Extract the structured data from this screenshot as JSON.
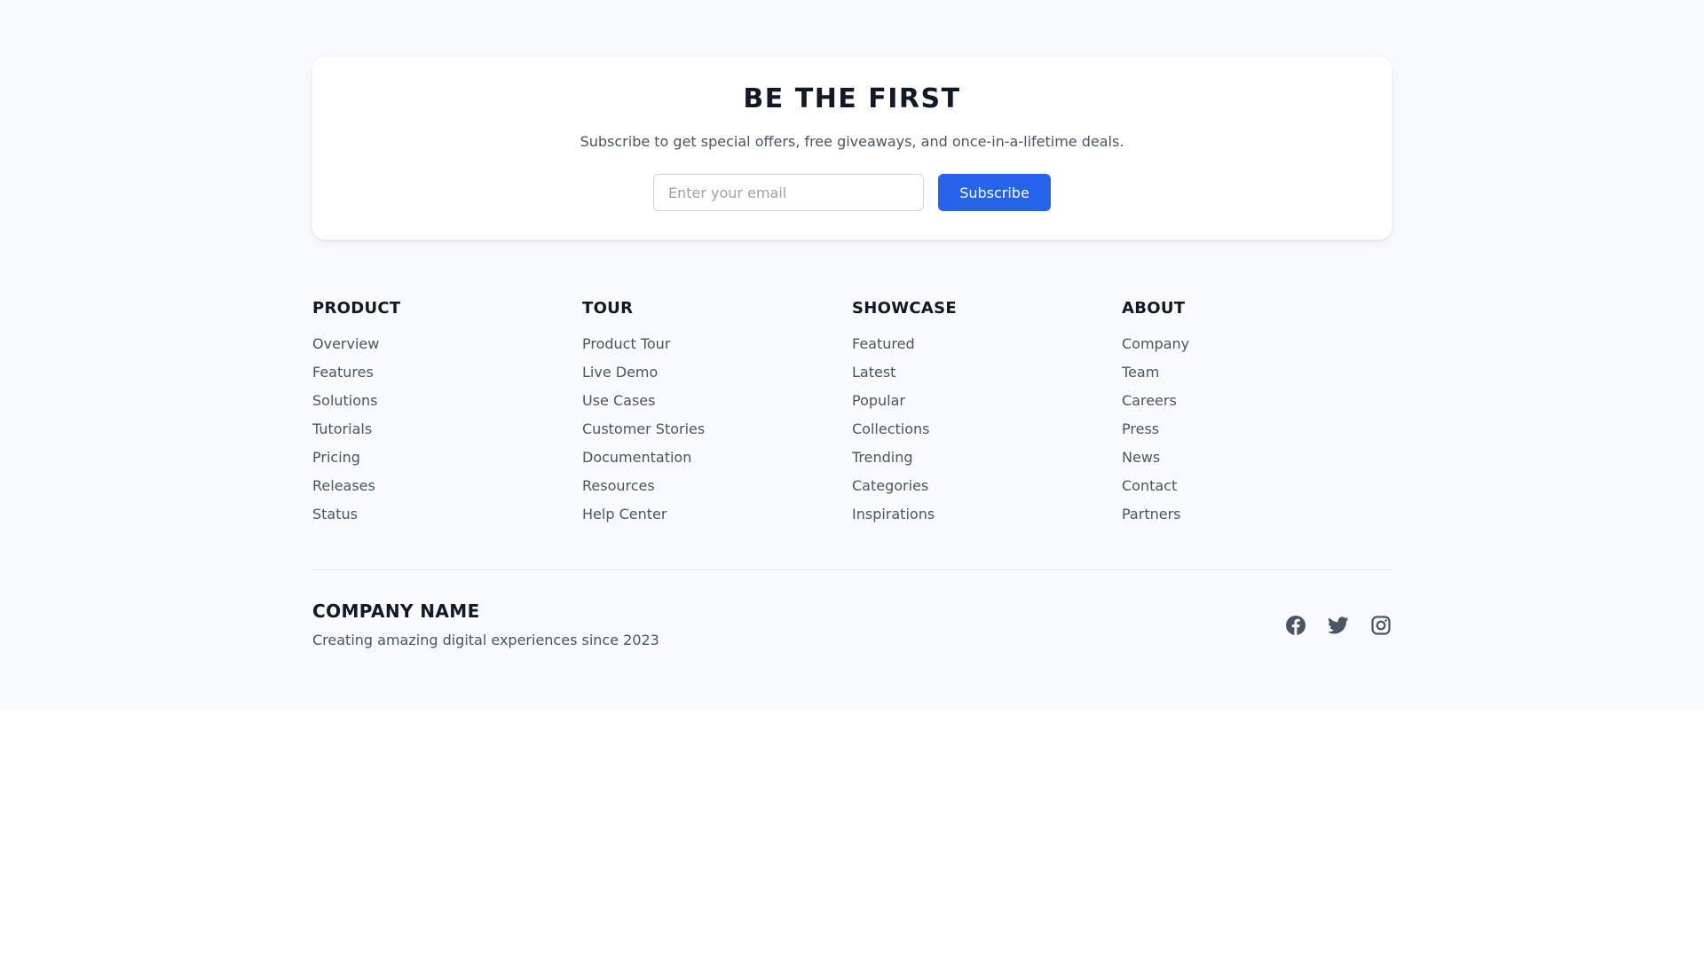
{
  "newsletter": {
    "title": "BE THE FIRST",
    "subtitle": "Subscribe to get special offers, free giveaways, and once-in-a-lifetime deals.",
    "email_placeholder": "Enter your email",
    "email_value": "",
    "subscribe_label": "Subscribe"
  },
  "columns": [
    {
      "title": "PRODUCT",
      "links": [
        "Overview",
        "Features",
        "Solutions",
        "Tutorials",
        "Pricing",
        "Releases",
        "Status"
      ]
    },
    {
      "title": "TOUR",
      "links": [
        "Product Tour",
        "Live Demo",
        "Use Cases",
        "Customer Stories",
        "Documentation",
        "Resources",
        "Help Center"
      ]
    },
    {
      "title": "SHOWCASE",
      "links": [
        "Featured",
        "Latest",
        "Popular",
        "Collections",
        "Trending",
        "Categories",
        "Inspirations"
      ]
    },
    {
      "title": "ABOUT",
      "links": [
        "Company",
        "Team",
        "Careers",
        "Press",
        "News",
        "Contact",
        "Partners"
      ]
    }
  ],
  "company": {
    "name": "COMPANY NAME",
    "tagline": "Creating amazing digital experiences since 2023"
  },
  "socials": [
    {
      "icon": "facebook-icon"
    },
    {
      "icon": "twitter-icon"
    },
    {
      "icon": "instagram-icon"
    }
  ],
  "colors": {
    "accent": "#2563eb",
    "background": "#f9fafb",
    "text_muted": "#4b5563",
    "heading": "#111827",
    "icon": "#4b5563"
  }
}
